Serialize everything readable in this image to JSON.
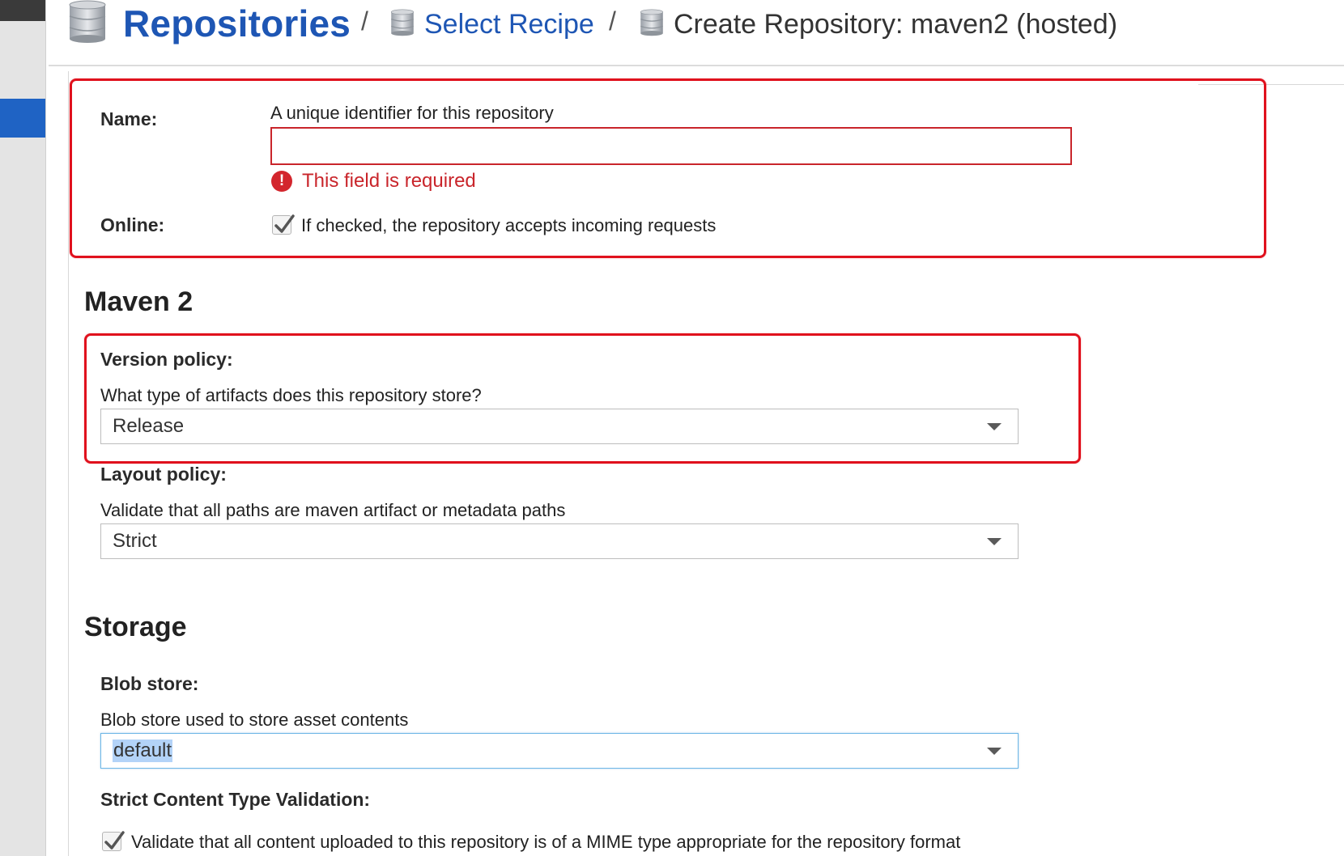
{
  "breadcrumb": {
    "root": "Repositories",
    "separator": "/",
    "recipe": "Select Recipe",
    "current": "Create Repository: maven2 (hosted)"
  },
  "form": {
    "name": {
      "label": "Name:",
      "help": "A unique identifier for this repository",
      "value": "",
      "error": "This field is required"
    },
    "online": {
      "label": "Online:",
      "checked": true,
      "help": "If checked, the repository accepts incoming requests"
    }
  },
  "maven": {
    "title": "Maven 2",
    "version_policy": {
      "label": "Version policy:",
      "help": "What type of artifacts does this repository store?",
      "value": "Release"
    },
    "layout_policy": {
      "label": "Layout policy:",
      "help": "Validate that all paths are maven artifact or metadata paths",
      "value": "Strict"
    }
  },
  "storage": {
    "title": "Storage",
    "blob_store": {
      "label": "Blob store:",
      "help": "Blob store used to store asset contents",
      "value": "default"
    },
    "strict_content": {
      "label": "Strict Content Type Validation:",
      "checked": true,
      "help": "Validate that all content uploaded to this repository is of a MIME type appropriate for the repository format"
    }
  },
  "colors": {
    "link": "#1e56b4",
    "error": "#c9252b",
    "highlight": "#e0111d",
    "sidebar_active": "#1f63c4"
  },
  "icons": {
    "database": "database-icon",
    "error": "exclamation-circle-icon",
    "check": "checkmark-icon",
    "dropdown": "caret-down-icon"
  }
}
